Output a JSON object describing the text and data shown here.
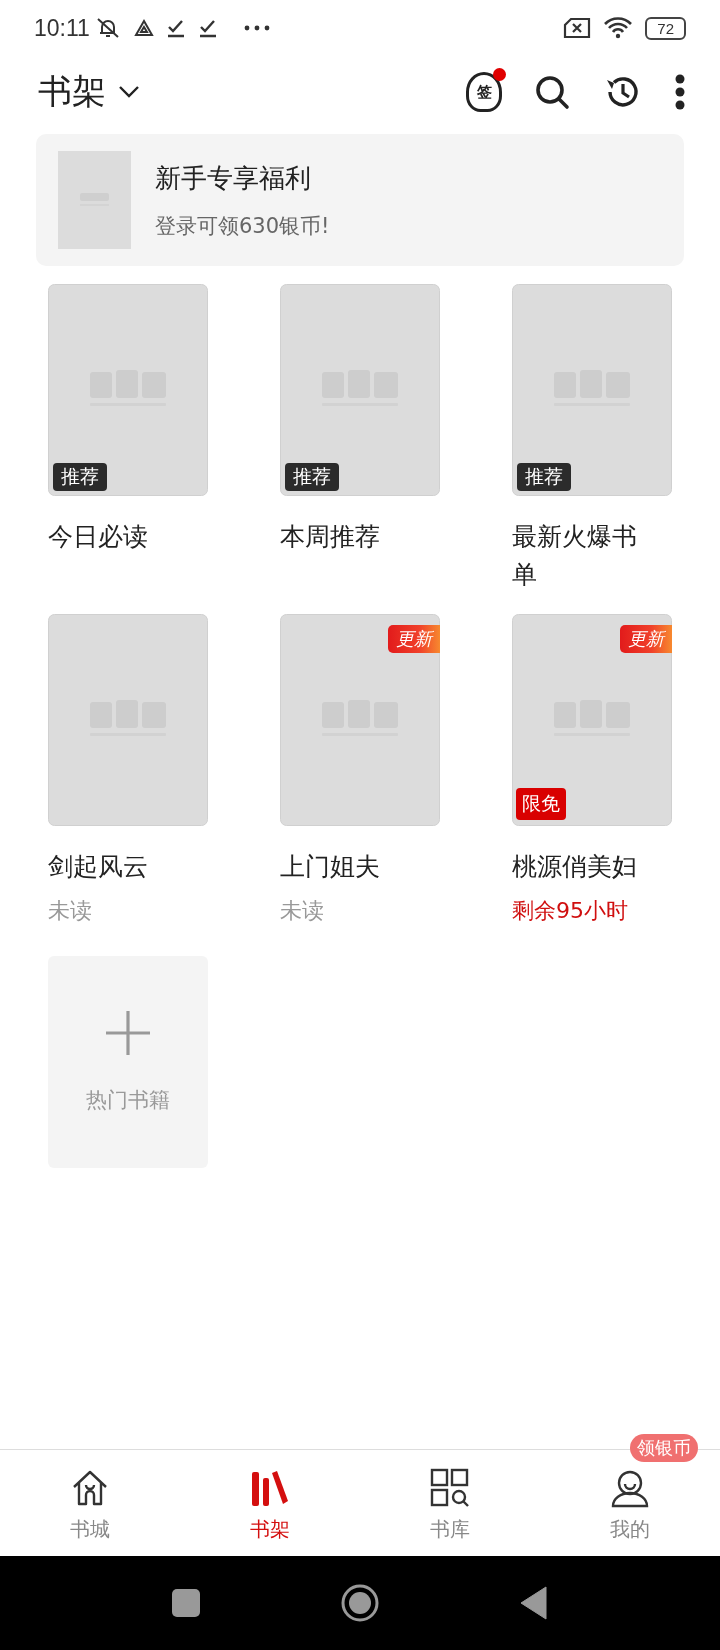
{
  "status_bar": {
    "time": "10:11",
    "battery": "72"
  },
  "header": {
    "title": "书架",
    "sign_badge": "签",
    "sign_dot": true
  },
  "banner": {
    "title": "新手专享福利",
    "subtitle": "登录可领630银币!"
  },
  "books": [
    {
      "title": "今日必读",
      "tag": {
        "kind": "recommend",
        "text": "推荐"
      }
    },
    {
      "title": "本周推荐",
      "tag": {
        "kind": "recommend",
        "text": "推荐"
      }
    },
    {
      "title": "最新火爆书单",
      "tag": {
        "kind": "recommend",
        "text": "推荐"
      }
    },
    {
      "title": "剑起风云",
      "status": {
        "kind": "unread",
        "text": "未读"
      }
    },
    {
      "title": "上门姐夫",
      "update_badge": "更新",
      "status": {
        "kind": "unread",
        "text": "未读"
      }
    },
    {
      "title": "桃源俏美妇",
      "update_badge": "更新",
      "tag": {
        "kind": "free",
        "text": "限免"
      },
      "status": {
        "kind": "countdown",
        "text": "剩余95小时"
      }
    }
  ],
  "add_tile": {
    "label": "热门书籍"
  },
  "nav": {
    "items": [
      {
        "label": "书城",
        "kind": "home",
        "selected": false
      },
      {
        "label": "书架",
        "kind": "shelf",
        "selected": true
      },
      {
        "label": "书库",
        "kind": "library",
        "selected": false
      },
      {
        "label": "我的",
        "kind": "me",
        "selected": false,
        "badge": "领银币"
      }
    ]
  }
}
